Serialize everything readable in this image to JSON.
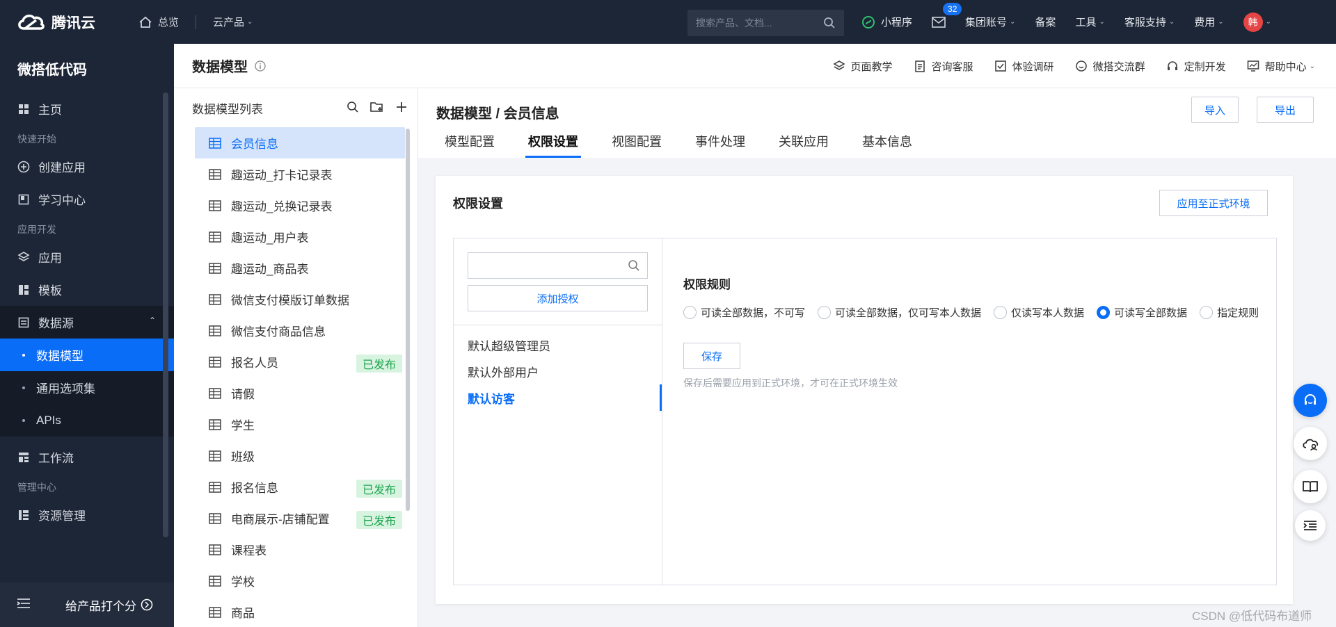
{
  "topbar": {
    "brand": "腾讯云",
    "home": "总览",
    "products": "云产品",
    "search_placeholder": "搜索产品、文档...",
    "mini_program": "小程序",
    "mail_badge": "32",
    "group_account": "集团账号",
    "filing": "备案",
    "tools": "工具",
    "support": "客服支持",
    "fees": "费用",
    "avatar": "韩"
  },
  "sidebar": {
    "app_title": "微搭低代码",
    "home": "主页",
    "group_quickstart": "快速开始",
    "create_app": "创建应用",
    "learning": "学习中心",
    "group_dev": "应用开发",
    "apps": "应用",
    "templates": "模板",
    "datasource": "数据源",
    "data_model": "数据模型",
    "option_sets": "通用选项集",
    "apis": "APIs",
    "workflow": "工作流",
    "group_admin": "管理中心",
    "resources": "资源管理",
    "rate": "给产品打个分"
  },
  "pagehead": {
    "title": "数据模型",
    "links": [
      "页面教学",
      "咨询客服",
      "体验调研",
      "微搭交流群",
      "定制开发",
      "帮助中心"
    ]
  },
  "modellist": {
    "title": "数据模型列表",
    "published_label": "已发布",
    "items": [
      {
        "name": "会员信息",
        "published": false
      },
      {
        "name": "趣运动_打卡记录表",
        "published": false
      },
      {
        "name": "趣运动_兑换记录表",
        "published": false
      },
      {
        "name": "趣运动_用户表",
        "published": false
      },
      {
        "name": "趣运动_商品表",
        "published": false
      },
      {
        "name": "微信支付模版订单数据",
        "published": false
      },
      {
        "name": "微信支付商品信息",
        "published": false
      },
      {
        "name": "报名人员",
        "published": true
      },
      {
        "name": "请假",
        "published": false
      },
      {
        "name": "学生",
        "published": false
      },
      {
        "name": "班级",
        "published": false
      },
      {
        "name": "报名信息",
        "published": true
      },
      {
        "name": "电商展示-店铺配置",
        "published": true
      },
      {
        "name": "课程表",
        "published": false
      },
      {
        "name": "学校",
        "published": false
      },
      {
        "name": "商品",
        "published": false
      }
    ]
  },
  "main": {
    "breadcrumb": "数据模型 / 会员信息",
    "import": "导入",
    "export": "导出",
    "tabs": [
      "模型配置",
      "权限设置",
      "视图配置",
      "事件处理",
      "关联应用",
      "基本信息"
    ],
    "active_tab": "权限设置",
    "card_title": "权限设置",
    "apply_prod": "应用至正式环境",
    "add_auth": "添加授权",
    "roles": [
      "默认超级管理员",
      "默认外部用户",
      "默认访客"
    ],
    "active_role": "默认访客",
    "rule_title": "权限规则",
    "rules": [
      "可读全部数据，不可写",
      "可读全部数据，仅可写本人数据",
      "仅读写本人数据",
      "可读写全部数据",
      "指定规则"
    ],
    "selected_rule": "可读写全部数据",
    "save": "保存",
    "save_hint": "保存后需要应用到正式环境，才可在正式环境生效"
  },
  "watermark": "CSDN @低代码布道师",
  "colors": {
    "accent": "#0a6df7",
    "nav_bg": "#1d2636",
    "published_bg": "#d8f4e1",
    "published_text": "#1aa34a"
  }
}
